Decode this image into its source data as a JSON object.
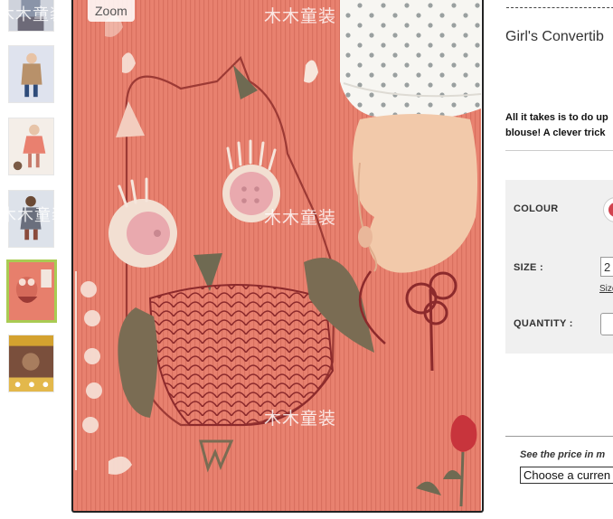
{
  "zoom_label": "Zoom",
  "watermark_text": "木木童装",
  "thumbnails": [
    {
      "name": "thumbnail-1",
      "selected": false
    },
    {
      "name": "thumbnail-2",
      "selected": false
    },
    {
      "name": "thumbnail-3",
      "selected": false
    },
    {
      "name": "thumbnail-4",
      "selected": false
    },
    {
      "name": "thumbnail-5",
      "selected": true
    },
    {
      "name": "thumbnail-6",
      "selected": false
    }
  ],
  "product": {
    "title": "Girl's Convertib",
    "description_line1": "All it takes is to do up",
    "description_line2": "blouse! A clever trick"
  },
  "options": {
    "colour_label": "COLOUR",
    "colour_value": "#d2434e",
    "size_label": "SIZE :",
    "size_value": "2",
    "size_guide": "Size",
    "quantity_label": "QUANTITY :"
  },
  "price_note": "See the price in m",
  "currency_select": "Choose a curren",
  "colors": {
    "accent_selected": "#a9cb53",
    "fabric": "#e8816f"
  }
}
